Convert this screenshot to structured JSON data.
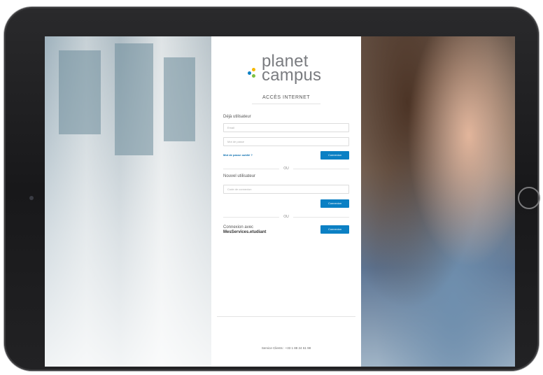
{
  "brand": {
    "line1": "planet",
    "line2": "campus",
    "colors": {
      "dot_blue": "#0b80c4",
      "dot_yellow": "#f5b800",
      "dot_green": "#7cc142",
      "text": "#7a7c80"
    }
  },
  "page": {
    "title": "ACCÈS INTERNET"
  },
  "existing_user": {
    "label": "Déjà utilisateur",
    "email_placeholder": "Email",
    "password_placeholder": "Mot de passe",
    "forgot_link": "Mot de passe oublié ?",
    "login_button": "Connexion"
  },
  "separator": "OU",
  "new_user": {
    "label": "Nouvel utilisateur",
    "code_placeholder": "Code de connexion",
    "login_button": "Connexion"
  },
  "mes_services": {
    "label_line1": "Connexion avec",
    "label_line2": "MesServices.etudiant",
    "login_button": "Connexion"
  },
  "footer": {
    "service_client": "Service Clients : +33 1 88 24 61 98",
    "accent_color": "#0b80c4"
  }
}
